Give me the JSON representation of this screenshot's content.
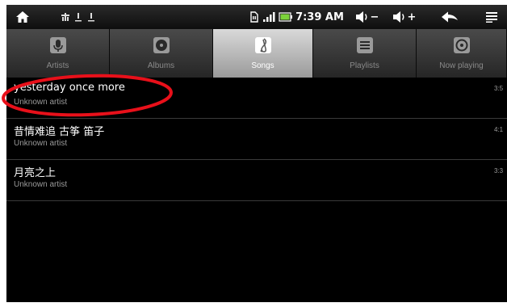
{
  "status_bar": {
    "home_icon": "home-icon",
    "notification_icons": [
      "usb-icon",
      "warning-icon",
      "warning-icon"
    ],
    "sd_icon": "sd-card-icon",
    "signal_icon": "signal-icon",
    "battery_icon": "battery-icon",
    "time": "7:39 AM",
    "volume_down_label": "−",
    "volume_up_label": "+",
    "back_icon": "back-arrow-icon",
    "menu_icon": "menu-icon"
  },
  "tabs": [
    {
      "label": "Artists",
      "icon": "microphone-icon",
      "selected": false
    },
    {
      "label": "Albums",
      "icon": "disc-icon",
      "selected": false
    },
    {
      "label": "Songs",
      "icon": "music-note-icon",
      "selected": true
    },
    {
      "label": "Playlists",
      "icon": "playlist-icon",
      "selected": false
    },
    {
      "label": "Now playing",
      "icon": "now-playing-icon",
      "selected": false
    }
  ],
  "songs": [
    {
      "title": "yesterday once more",
      "artist": "Unknown artist",
      "duration": "3:5"
    },
    {
      "title": "昔情难追 古筝 笛子",
      "artist": "Unknown artist",
      "duration": "4:1"
    },
    {
      "title": "月亮之上",
      "artist": "Unknown artist",
      "duration": "3:3"
    }
  ],
  "colors": {
    "annotation": "#e8101a",
    "background": "#000000",
    "selected_tab": "#c8c8c8",
    "divider": "#3a3a3a"
  }
}
